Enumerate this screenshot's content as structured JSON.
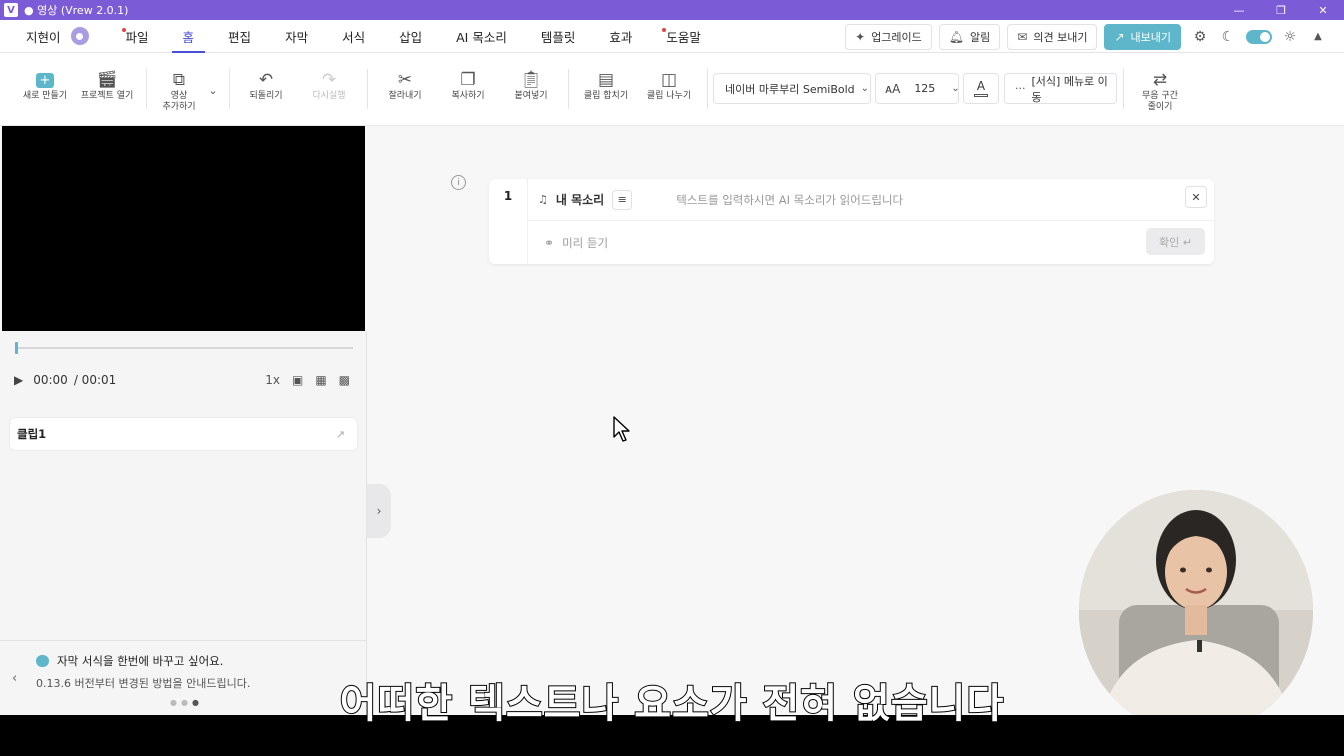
{
  "window": {
    "title": "● 영상 (Vrew 2.0.1)",
    "app_logo": "V"
  },
  "menubar": {
    "user_name": "지현이",
    "items": [
      {
        "label": "파일",
        "dot": true
      },
      {
        "label": "홈",
        "active": true
      },
      {
        "label": "편집"
      },
      {
        "label": "자막"
      },
      {
        "label": "서식"
      },
      {
        "label": "삽입"
      },
      {
        "label": "AI 목소리"
      },
      {
        "label": "템플릿"
      },
      {
        "label": "효과"
      },
      {
        "label": "도움말",
        "dot": true
      }
    ],
    "upgrade": "업그레이드",
    "notifications": "알림",
    "feedback": "의견 보내기",
    "export": "내보내기"
  },
  "toolbar": {
    "new_project": "새로 만들기",
    "open_project": "프로젝트 열기",
    "add_video_1": "영상",
    "add_video_2": "추가하기",
    "undo": "되돌리기",
    "redo": "다시실행",
    "cut": "잘라내기",
    "copy": "복사하기",
    "paste": "붙여넣기",
    "merge_clips": "클립 합치기",
    "split_clip": "클립 나누기",
    "font": "네이버 마루부리 SemiBold",
    "font_size": "125",
    "more_format": "[서식] 메뉴로 이동",
    "silence_1": "무음 구간",
    "silence_2": "줄이기"
  },
  "player": {
    "current_time": "00:00",
    "total_time": "/ 00:01",
    "speed": "1x",
    "progress": 0.0
  },
  "clips": [
    {
      "label": "클립1"
    }
  ],
  "tip": {
    "title": "자막 서식을 한번에 바꾸고 싶어요.",
    "body": "0.13.6 버전부터 변경된 방법을 안내드립니다."
  },
  "voice_card": {
    "index": "1",
    "voice_name": "내 목소리",
    "placeholder": "텍스트를 입력하시면 AI 목소리가 읽어드립니다",
    "preview": "미리 듣기",
    "confirm": "확인 ↵"
  },
  "subtitle": "어떠한 텍스트나 요소가 전혀 없습니다",
  "colors": {
    "accent": "#5db6c9",
    "titlebar": "#7b5bd6",
    "active_tab": "#4a4fd6"
  }
}
